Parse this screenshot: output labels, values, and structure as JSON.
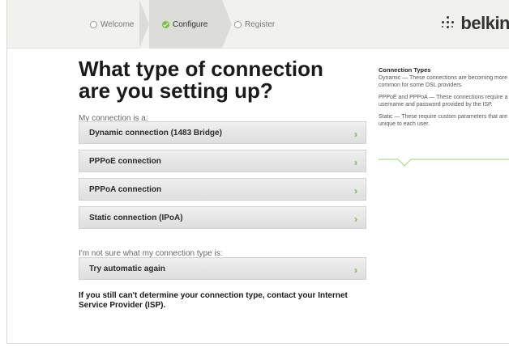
{
  "steps": [
    {
      "label": "Welcome",
      "state": "pending"
    },
    {
      "label": "Configure",
      "state": "active"
    },
    {
      "label": "Register",
      "state": "pending"
    }
  ],
  "brand": {
    "name": "belkin"
  },
  "colors": {
    "accent_green": "#7bc242",
    "header_bg": "#f1f1ee"
  },
  "main": {
    "title": "What type of connection are you setting up?",
    "connection_label": "My connection is a:",
    "options": [
      {
        "label": "Dynamic connection (1483 Bridge)",
        "icon": "double-chevron-right-icon"
      },
      {
        "label": "PPPoE connection",
        "icon": "double-chevron-right-icon"
      },
      {
        "label": "PPPoA connection",
        "icon": "double-chevron-right-icon"
      },
      {
        "label": "Static connection (IPoA)",
        "icon": "double-chevron-right-icon"
      }
    ],
    "unsure_label": "I'm not sure what my connection type is:",
    "retry": {
      "label": "Try automatic again",
      "icon": "double-chevron-right-icon"
    },
    "note": "If you still can't determine your connection type, contact your Internet Service Provider (ISP)."
  },
  "sidebar": {
    "title": "Connection Types",
    "paragraphs": [
      "Dynamic — These connections are becoming more common for some DSL providers.",
      "PPPoE and PPPoA — These connections require a username and password provided by the ISP.",
      "Static — These require custom parameters that are unique to each user."
    ]
  }
}
